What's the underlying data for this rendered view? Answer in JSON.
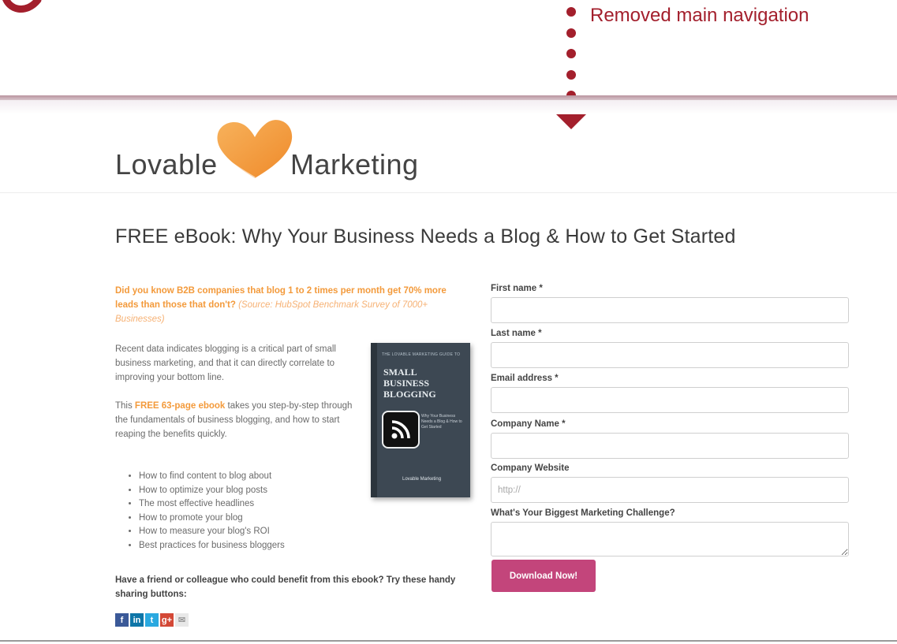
{
  "annotation": {
    "label": "Removed main navigation",
    "color": "#a31f2c"
  },
  "brand": {
    "name_left": "Lovable",
    "name_right": "Marketing",
    "heart_color": "#f39a3b"
  },
  "page": {
    "title": "FREE eBook: Why Your Business Needs a Blog & How to Get Started"
  },
  "intro": {
    "stat": "Did you know B2B companies that blog 1 to 2 times per month get 70% more leads than those that don't?",
    "source": "(Source: HubSpot Benchmark Survey of 7000+ Businesses)"
  },
  "body": {
    "para1": "Recent data indicates blogging is a critical part of small business marketing, and that it can directly correlate to improving your bottom line.",
    "para2_prefix": "This ",
    "para2_highlight": "FREE 63-page ebook",
    "para2_suffix": " takes you step-by-step through the fundamentals of business blogging, and how to start reaping the benefits quickly."
  },
  "bullets": [
    "How to find content to blog about",
    "How to optimize your blog posts",
    "The most effective headlines",
    "How to promote your blog",
    "How to measure your blog's ROI",
    "Best practices for business bloggers"
  ],
  "book": {
    "top_text": "THE LOVABLE MARKETING GUIDE TO",
    "title": "SMALL BUSINESS BLOGGING",
    "subtitle": "Why Your Business Needs a Blog & How to Get Started",
    "logo": "Lovable Marketing",
    "cover_color": "#3d4853"
  },
  "share": {
    "prompt": "Have a friend or colleague who could benefit from this ebook?  Try these handy sharing buttons:",
    "buttons": [
      {
        "icon": "facebook-icon",
        "glyph": "f",
        "color": "#3b5998"
      },
      {
        "icon": "linkedin-icon",
        "glyph": "in",
        "color": "#0e76a8"
      },
      {
        "icon": "twitter-icon",
        "glyph": "t",
        "color": "#2aa9e0"
      },
      {
        "icon": "google-plus-icon",
        "glyph": "g+",
        "color": "#d34836"
      },
      {
        "icon": "email-icon",
        "glyph": "✉",
        "color": "#d9d9d9"
      }
    ]
  },
  "form": {
    "first_name_label": "First name *",
    "last_name_label": "Last name *",
    "email_label": "Email address *",
    "company_name_label": "Company Name *",
    "company_website_label": "Company Website",
    "company_website_placeholder": "http://",
    "challenge_label": "What's Your Biggest Marketing Challenge?",
    "submit_label": "Download Now!",
    "submit_color": "#c3457b"
  }
}
